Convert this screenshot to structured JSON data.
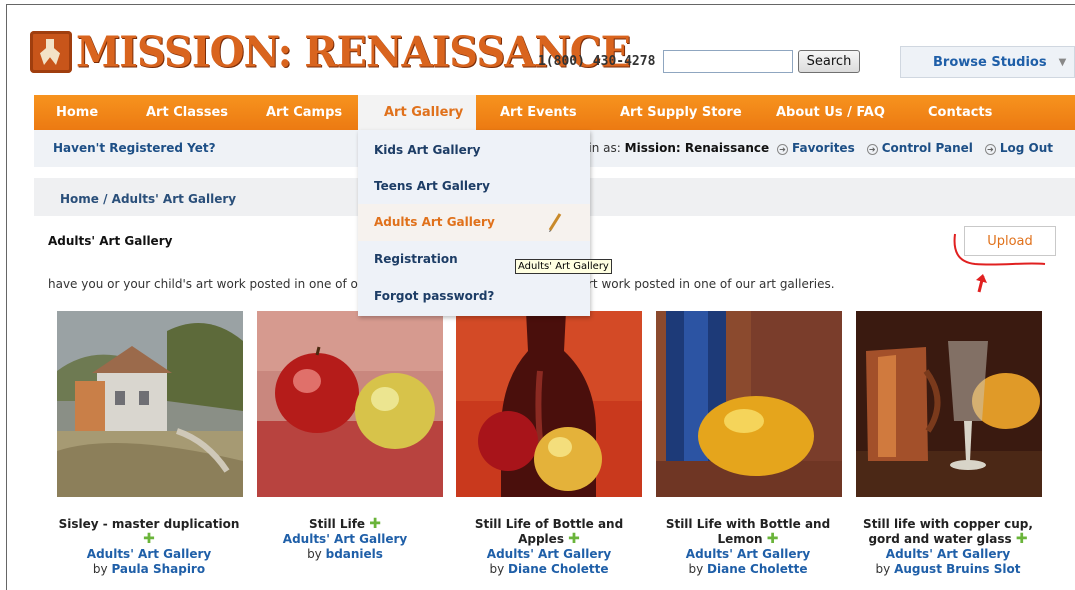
{
  "header": {
    "logo_text": "MISSION: RENAISSANCE",
    "phone": "1(800) 430-4278",
    "search_value": "",
    "search_button": "Search",
    "browse_label": "Browse Studios"
  },
  "nav": {
    "items": [
      {
        "label": "Home"
      },
      {
        "label": "Art Classes"
      },
      {
        "label": "Art Camps"
      },
      {
        "label": "Art Gallery"
      },
      {
        "label": "Art Events"
      },
      {
        "label": "Art Supply Store"
      },
      {
        "label": "About Us / FAQ"
      },
      {
        "label": "Contacts"
      }
    ],
    "active": "Art Gallery"
  },
  "subbar": {
    "not_registered": "Haven't Registered Yet?",
    "logged_prefix": "d in as: ",
    "logged_user": "Mission: Renaissance",
    "links": [
      "Favorites",
      "Control Panel",
      "Log Out"
    ]
  },
  "breadcrumb": "Home / Adults' Art Gallery",
  "page": {
    "title": "Adults' Art Gallery",
    "upload_label": "Upload",
    "intro_left": "have you or your child's art work posted in one of ou",
    "intro_right": "rt work posted in one of our art galleries."
  },
  "dropdown": {
    "items": [
      {
        "label": "Kids Art Gallery"
      },
      {
        "label": "Teens Art Gallery"
      },
      {
        "label": "Adults Art Gallery"
      },
      {
        "label": "Registration"
      },
      {
        "label": "Forgot password?"
      }
    ],
    "hovered": "Adults Art Gallery",
    "tooltip": "Adults' Art Gallery"
  },
  "gallery": [
    {
      "title": "Sisley - master duplication",
      "gallery": "Adults' Art Gallery",
      "by_prefix": "by",
      "author": "Paula Shapiro"
    },
    {
      "title": "Still Life",
      "gallery": "Adults' Art Gallery",
      "by_prefix": "by",
      "author": "bdaniels"
    },
    {
      "title": "Still Life of Bottle and Apples",
      "gallery": "Adults' Art Gallery",
      "by_prefix": "by",
      "author": "Diane Cholette"
    },
    {
      "title": "Still Life with Bottle and Lemon",
      "gallery": "Adults' Art Gallery",
      "by_prefix": "by",
      "author": "Diane Cholette"
    },
    {
      "title": "Still life with copper cup, gord and water glass",
      "gallery": "Adults' Art Gallery",
      "by_prefix": "by",
      "author": "August Bruins Slot"
    }
  ],
  "colors": {
    "nav_orange": "#ef8115",
    "link_blue": "#1f5fa8",
    "accent_orange": "#e0711b",
    "add_green": "#6ab43a",
    "annotation_red": "#e02020"
  }
}
